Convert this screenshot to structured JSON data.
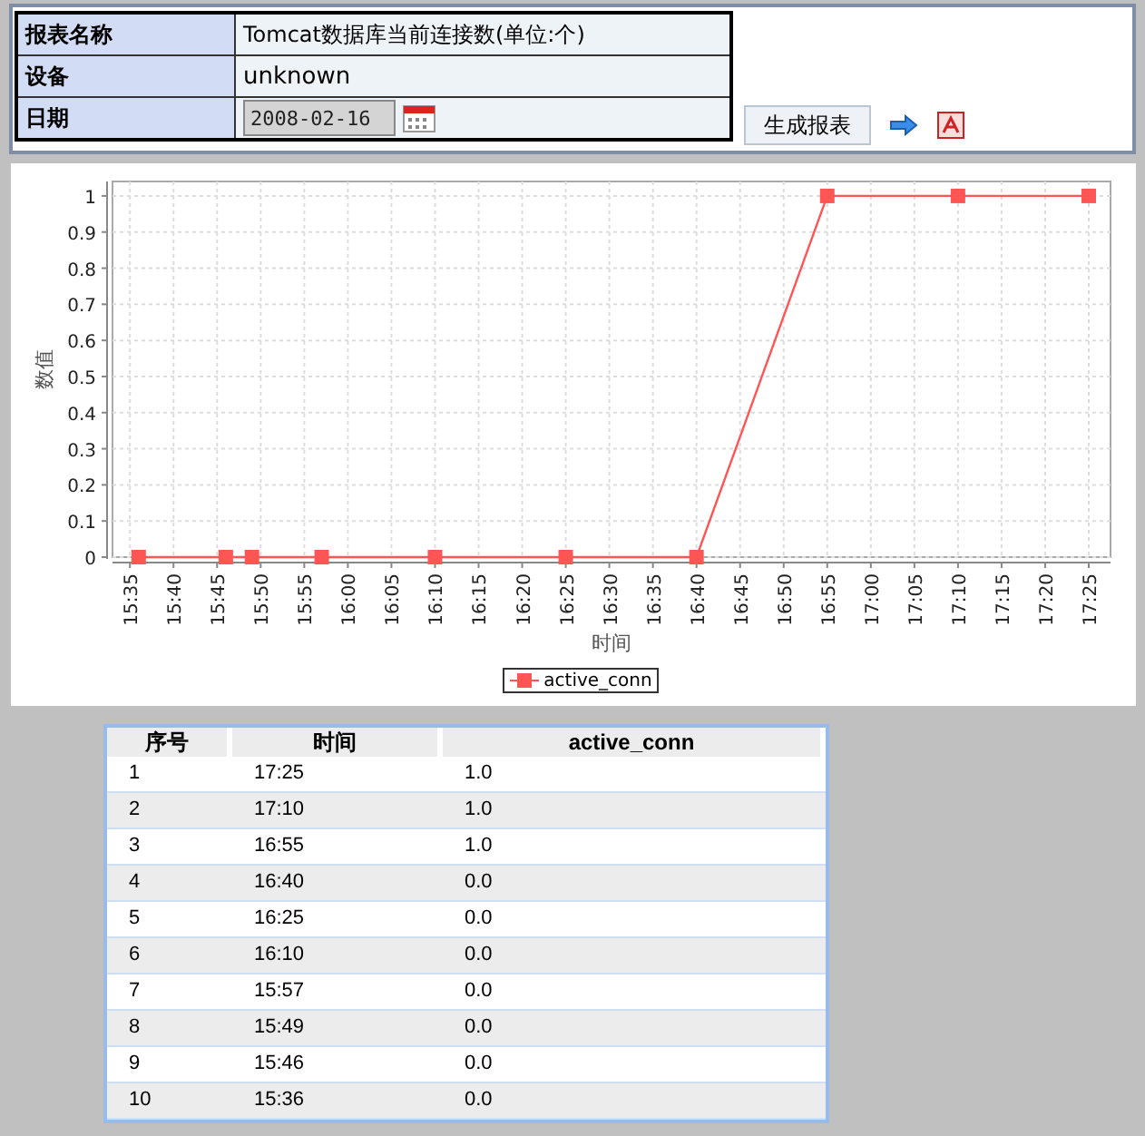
{
  "report_info": {
    "rows": [
      {
        "label": "报表名称",
        "kind": "text",
        "value": "Tomcat数据库当前连接数(单位:个)"
      },
      {
        "label": "设备",
        "kind": "text",
        "value": "unknown"
      },
      {
        "label": "日期",
        "kind": "date",
        "value": "2008-02-16"
      }
    ]
  },
  "toolbar": {
    "generate_button": "生成报表"
  },
  "chart": {
    "chart_data": {
      "type": "line",
      "grid": true,
      "xlabel": "时间",
      "ylabel": "数值",
      "x": [
        936,
        946,
        949,
        957,
        970,
        985,
        1000,
        1015,
        1030,
        1045
      ],
      "series": [
        {
          "name": "active_conn",
          "color": "#ff5555",
          "marker": "square",
          "values": [
            0,
            0,
            0,
            0,
            0,
            0,
            0,
            1,
            1,
            1
          ]
        }
      ],
      "xlim": [
        933,
        1047.5
      ],
      "ylim": [
        0,
        1.04
      ],
      "xticks": [
        {
          "value": 935,
          "label": "15:35"
        },
        {
          "value": 940,
          "label": "15:40"
        },
        {
          "value": 945,
          "label": "15:45"
        },
        {
          "value": 950,
          "label": "15:50"
        },
        {
          "value": 955,
          "label": "15:55"
        },
        {
          "value": 960,
          "label": "16:00"
        },
        {
          "value": 965,
          "label": "16:05"
        },
        {
          "value": 970,
          "label": "16:10"
        },
        {
          "value": 975,
          "label": "16:15"
        },
        {
          "value": 980,
          "label": "16:20"
        },
        {
          "value": 985,
          "label": "16:25"
        },
        {
          "value": 990,
          "label": "16:30"
        },
        {
          "value": 995,
          "label": "16:35"
        },
        {
          "value": 1000,
          "label": "16:40"
        },
        {
          "value": 1005,
          "label": "16:45"
        },
        {
          "value": 1010,
          "label": "16:50"
        },
        {
          "value": 1015,
          "label": "16:55"
        },
        {
          "value": 1020,
          "label": "17:00"
        },
        {
          "value": 1025,
          "label": "17:05"
        },
        {
          "value": 1030,
          "label": "17:10"
        },
        {
          "value": 1035,
          "label": "17:15"
        },
        {
          "value": 1040,
          "label": "17:20"
        },
        {
          "value": 1045,
          "label": "17:25"
        }
      ],
      "yticks": [
        0,
        {
          "value": 0.1,
          "label": "0.1"
        },
        {
          "value": 0.2,
          "label": "0.2"
        },
        {
          "value": 0.3,
          "label": "0.3"
        },
        {
          "value": 0.4,
          "label": "0.4"
        },
        {
          "value": 0.5,
          "label": "0.5"
        },
        {
          "value": 0.6,
          "label": "0.6"
        },
        {
          "value": 0.7,
          "label": "0.7"
        },
        {
          "value": 0.8,
          "label": "0.8"
        },
        {
          "value": 0.9,
          "label": "0.9"
        },
        1
      ]
    }
  },
  "table": {
    "columns": [
      "序号",
      "时间",
      "active_conn"
    ],
    "rows": [
      [
        "1",
        "17:25",
        "1.0"
      ],
      [
        "2",
        "17:10",
        "1.0"
      ],
      [
        "3",
        "16:55",
        "1.0"
      ],
      [
        "4",
        "16:40",
        "0.0"
      ],
      [
        "5",
        "16:25",
        "0.0"
      ],
      [
        "6",
        "16:10",
        "0.0"
      ],
      [
        "7",
        "15:57",
        "0.0"
      ],
      [
        "8",
        "15:49",
        "0.0"
      ],
      [
        "9",
        "15:46",
        "0.0"
      ],
      [
        "10",
        "15:36",
        "0.0"
      ]
    ]
  }
}
